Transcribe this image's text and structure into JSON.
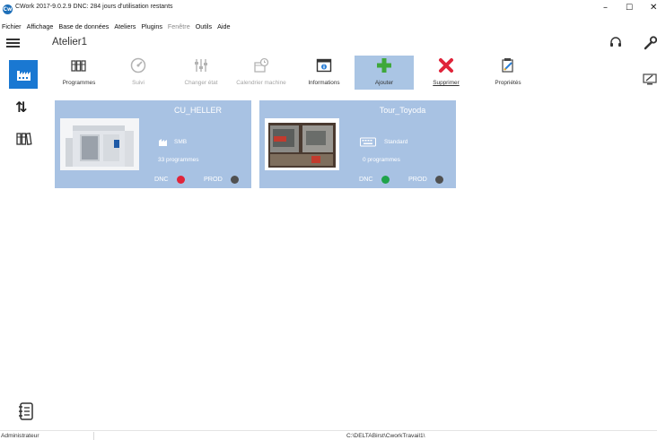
{
  "window": {
    "logo_text": "Cw",
    "title": "CWork 2017-9.0.2.9 DNC: 284 jours d'utilisation restants",
    "minimize": "–",
    "maximize": "☐",
    "close": "✕"
  },
  "menu": [
    {
      "label": "Fichier",
      "enabled": true
    },
    {
      "label": "Affichage",
      "enabled": true
    },
    {
      "label": "Base de données",
      "enabled": true
    },
    {
      "label": "Ateliers",
      "enabled": true
    },
    {
      "label": "Plugins",
      "enabled": true
    },
    {
      "label": "Fenêtre",
      "enabled": false
    },
    {
      "label": "Outils",
      "enabled": true
    },
    {
      "label": "Aide",
      "enabled": true
    }
  ],
  "header": {
    "title": "Atelier1"
  },
  "sidebar": {
    "items": [
      {
        "icon": "factory-icon",
        "active": true
      },
      {
        "icon": "transfer-arrows-icon",
        "glyph": "⇅"
      },
      {
        "icon": "books-icon"
      }
    ],
    "bottom_icon": "journal-icon"
  },
  "toolbar": {
    "programmes": "Programmes",
    "suivi": "Suivi",
    "changer_etat": "Changer état",
    "calendrier": "Calendrier machine",
    "informations": "Informations",
    "ajouter": "Ajouter",
    "supprimer": "Supprimer",
    "proprietes": "Propriétés",
    "active": "ajouter"
  },
  "machines": [
    {
      "name": "CU_HELLER",
      "type": "SMB",
      "programs": "33 programmes",
      "dnc_label": "DNC",
      "dnc_status_color": "#e0243a",
      "prod_label": "PROD",
      "prod_status_color": "#505050"
    },
    {
      "name": "Tour_Toyoda",
      "type": "Standard",
      "programs": "0 programmes",
      "dnc_label": "DNC",
      "dnc_status_color": "#1fa34a",
      "prod_label": "PROD",
      "prod_status_color": "#505050"
    }
  ],
  "statusbar": {
    "user": "Administrateur",
    "path": "C:\\DELTABirst\\CworkTravail1\\"
  },
  "colors": {
    "accent": "#1a78d2",
    "card": "#a8c2e3",
    "toolbar_active": "#aac5e4"
  }
}
